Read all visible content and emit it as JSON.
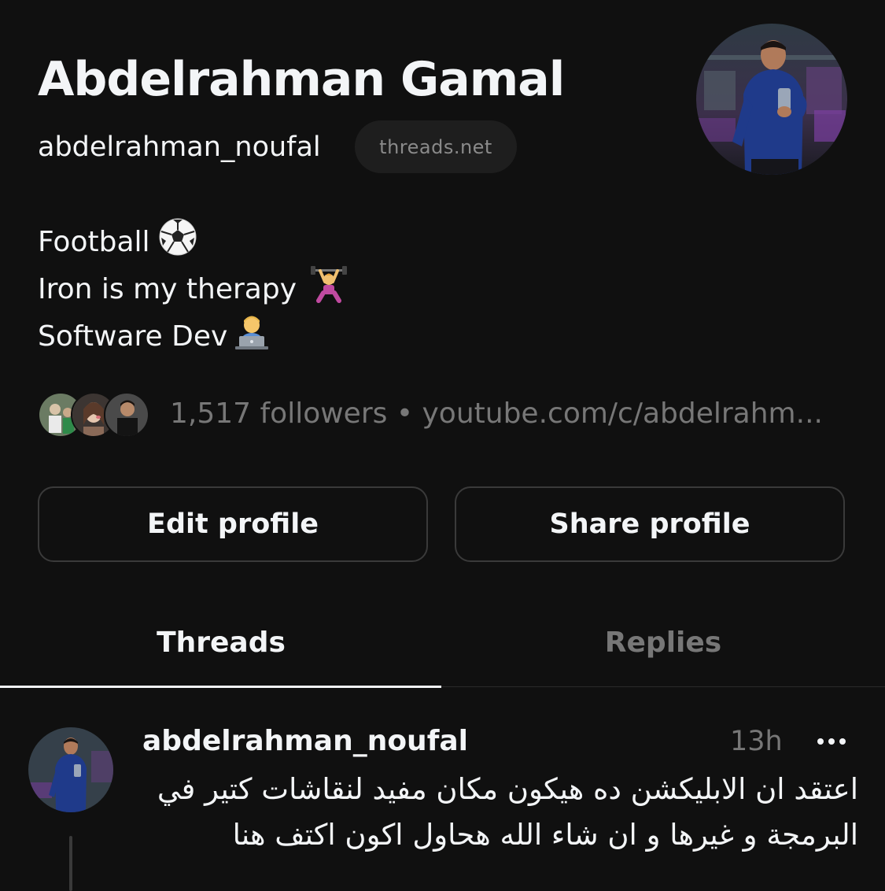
{
  "profile": {
    "display_name": "Abdelrahman Gamal",
    "username": "abdelrahman_noufal",
    "domain_badge": "threads.net",
    "avatar_icon": "profile-photo-gym-selfie"
  },
  "bio": {
    "lines": [
      {
        "text": "Football",
        "emoji": "soccer-ball-icon"
      },
      {
        "text": "Iron is my therapy",
        "emoji": "weightlifter-icon"
      },
      {
        "text": "Software Dev",
        "emoji": "technologist-icon"
      }
    ]
  },
  "followers": {
    "summary": "1,517 followers • youtube.com/c/abdelrahm..."
  },
  "actions": {
    "edit_label": "Edit profile",
    "share_label": "Share profile"
  },
  "tabs": [
    {
      "label": "Threads",
      "active": true
    },
    {
      "label": "Replies",
      "active": false
    }
  ],
  "post": {
    "username": "abdelrahman_noufal",
    "time": "13h",
    "text": "اعتقد ان الابليكشن ده هيكون مكان مفيد لنقاشات كتير في البرمجة و غيرها و ان شاء الله هحاول اكون اكتف هنا"
  },
  "colors": {
    "background": "#101010",
    "primary_text": "#f3f5f7",
    "secondary_text": "#777777",
    "border": "#3a3a3a"
  }
}
